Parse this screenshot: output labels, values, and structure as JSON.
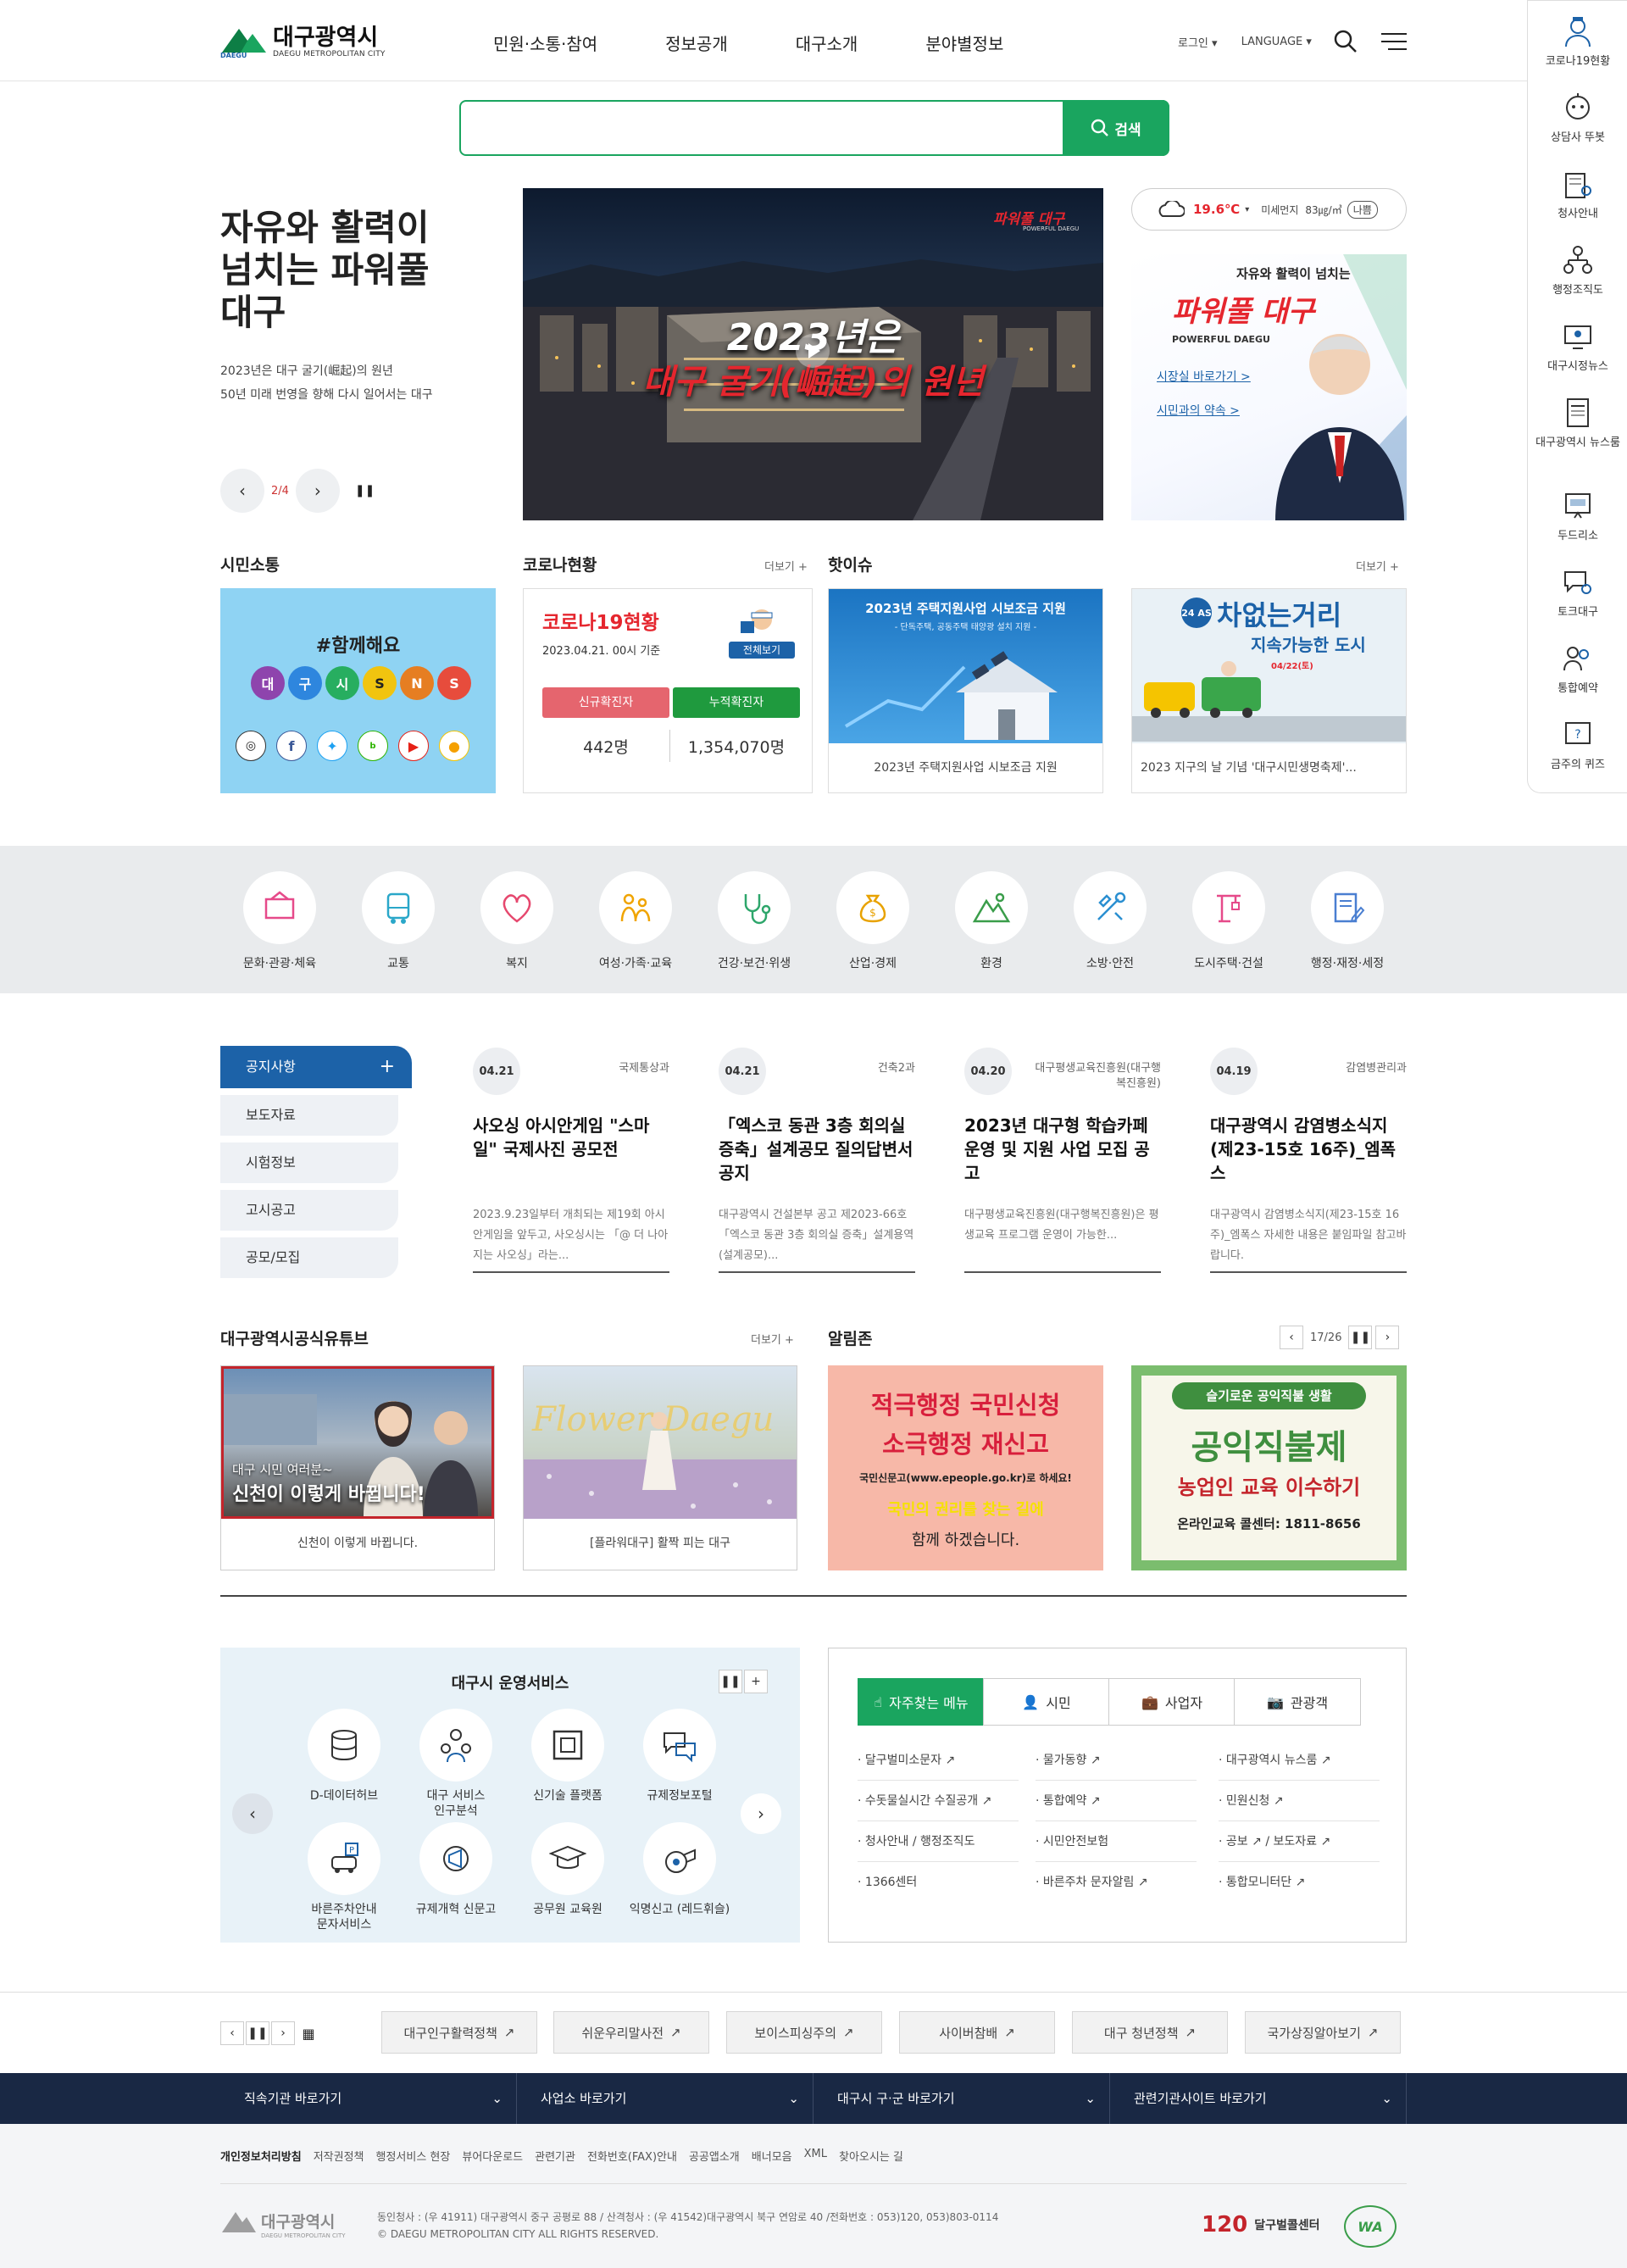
{
  "header": {
    "logo_text": "대구광역시",
    "logo_sub": "DAEGU METROPOLITAN CITY",
    "logo_mark": "DAEGU",
    "nav": [
      "민원·소통·참여",
      "정보공개",
      "대구소개",
      "분야별정보"
    ],
    "login": "로그인",
    "language": "LANGUAGE"
  },
  "quick_menu": [
    "코로나19현황",
    "상담사 뚜봇",
    "청사안내",
    "행정조직도",
    "대구시정뉴스",
    "대구광역시 뉴스룸",
    "두드리소",
    "토크대구",
    "통합예약",
    "금주의 퀴즈"
  ],
  "search": {
    "placeholder": "",
    "button": "검색"
  },
  "hero": {
    "title_lines": [
      "자유와 활력이",
      "넘치는 파워풀",
      "대구"
    ],
    "desc_lines": [
      "2023년은 대구 굴기(崛起)의 원년",
      "50년 미래 번영을 향해 다시 일어서는 대구"
    ],
    "page": "2/4",
    "image_brand": "파워풀 대구",
    "image_brand_sub": "POWERFUL DAEGU",
    "image_line1": "2023년은",
    "image_line2": "대구 굴기(崛起)의 원년"
  },
  "weather": {
    "temp": "19.6℃",
    "dust_label": "미세먼지",
    "dust_value": "83㎍/㎥",
    "dust_status": "나쁨"
  },
  "mayor": {
    "slogan": "자유와 활력이 넘치는",
    "title": "파워풀 대구",
    "sub": "POWERFUL DAEGU",
    "link1": "시장실 바로가기 >",
    "link2": "시민과의 약속 >"
  },
  "citizen": {
    "title": "시민소통",
    "hashtag": "#함께해요",
    "bubbles": [
      "대",
      "구",
      "시",
      "S",
      "N",
      "S"
    ]
  },
  "covid": {
    "title": "코로나현황",
    "more": "더보기 +",
    "card_title": "코로나19현황",
    "date": "2023.04.21. 00시 기준",
    "all_btn": "전체보기",
    "new_label": "신규확진자",
    "total_label": "누적확진자",
    "new_value": "442명",
    "total_value": "1,354,070명"
  },
  "hot": {
    "title": "핫이슈",
    "more": "더보기 +",
    "items": [
      {
        "img_title": "2023년 주택지원사업 시보조금 지원",
        "img_sub": "- 단독주택, 공동주택 태양광 설치 지원 -",
        "caption": "2023년 주택지원사업 시보조금 지원"
      },
      {
        "img_title": "차없는거리",
        "img_sub": "지속가능한 도시",
        "badge": "24 AS",
        "date_text": "04/22(토)",
        "caption": "2023 지구의 날 기념 '대구시민생명축제'..."
      }
    ]
  },
  "categories": [
    "문화·관광·체육",
    "교통",
    "복지",
    "여성·가족·교육",
    "건강·보건·위생",
    "산업·경제",
    "환경",
    "소방·안전",
    "도시주택·건설",
    "행정·재정·세정"
  ],
  "notice": {
    "tabs": [
      "공지사항",
      "보도자료",
      "시험정보",
      "고시공고",
      "공모/모집"
    ],
    "items": [
      {
        "date": "04.21",
        "dept": "국제통상과",
        "title": "사오싱 아시안게임 \"스마일\" 국제사진 공모전",
        "body": "2023.9.23일부터 개최되는 제19회 아시안게임을 앞두고, 사오싱시는 「@ 더 나아지는 사오싱」라는..."
      },
      {
        "date": "04.21",
        "dept": "건축2과",
        "title": "「엑스코 동관 3층 회의실 증축」설계공모 질의답변서 공지",
        "body": "대구광역시 건설본부 공고 제2023-66호 「엑스코 동관 3층 회의실 증축」설계용역(설계공모)..."
      },
      {
        "date": "04.20",
        "dept": "대구평생교육진흥원(대구행복진흥원)",
        "title": "2023년 대구형 학습카페 운영 및 지원 사업 모집 공고",
        "body": "대구평생교육진흥원(대구행복진흥원)은 평생교육 프로그램 운영이 가능한..."
      },
      {
        "date": "04.19",
        "dept": "감염병관리과",
        "title": "대구광역시 감염병소식지(제23-15호 16주)_엠폭스",
        "body": "대구광역시 감염병소식지(제23-15호 16주)_엠폭스 자세한 내용은 붙임파일 참고바랍니다."
      }
    ]
  },
  "youtube": {
    "title": "대구광역시공식유튜브",
    "more": "더보기 +",
    "items": [
      {
        "overlay1": "대구 시민 여러분~",
        "overlay2": "신천이 이렇게 바뀝니다!",
        "caption": "신천이 이렇게 바뀝니다."
      },
      {
        "overlay1": "Flower Daegu",
        "caption": "[플라워대구] 활짝 피는 대구"
      }
    ]
  },
  "alarm": {
    "title": "알림존",
    "page": "17/26",
    "items": [
      {
        "l1": "적극행정 국민신청",
        "l2": "소극행정 재신고",
        "l3": "국민신문고(www.epeople.go.kr)로 하세요!",
        "l4": "국민의 권리를 찾는 길에",
        "l5": "함께 하겠습니다."
      },
      {
        "l1": "슬기로운 공익직불 생활",
        "l2": "공익직불제",
        "l3": "농업인 교육 이수하기",
        "l4": "온라인교육 콜센터: 1811-8656"
      }
    ]
  },
  "ops": {
    "title": "대구시 운영서비스",
    "items": [
      "D-데이터허브",
      "대구 서비스 인구분석",
      "신기술 플랫폼",
      "규제정보포털",
      "바른주차안내 문자서비스",
      "규제개혁 신문고",
      "공무원 교육원",
      "익명신고 (레드휘슬)"
    ]
  },
  "fav": {
    "tabs": [
      "자주찾는 메뉴",
      "시민",
      "사업자",
      "관광객"
    ],
    "links": [
      "달구벌미소문자",
      "물가동향",
      "대구광역시 뉴스룸",
      "수돗물실시간 수질공개",
      "통합예약",
      "민원신청",
      "청사안내 / 행정조직도",
      "시민안전보험",
      "공보",
      "1366센터",
      "바른주차 문자알림",
      "통합모니터단"
    ],
    "link_extra": "/ 보도자료"
  },
  "banners": [
    "대구인구활력정책",
    "쉬운우리말사전",
    "보이스피싱주의",
    "사이버참배",
    "대구 청년정책",
    "국가상징알아보기"
  ],
  "sites": [
    "직속기관 바로가기",
    "사업소 바로가기",
    "대구시 구·군 바로가기",
    "관련기관사이트 바로가기"
  ],
  "footer": {
    "links": [
      "개인정보처리방침",
      "저작권정책",
      "행정서비스 현장",
      "뷰어다운로드",
      "관련기관",
      "전화번호(FAX)안내",
      "공공앱소개",
      "배너모음",
      "XML",
      "찾아오시는 길"
    ],
    "address": "동인청사 : (우 41911) 대구광역시 중구 공평로 88 / 산격청사 : (우 41542)대구광역시 북구 연암로 40 /전화번호 : 053)120, 053)803-0114",
    "copyright": "© DAEGU METROPOLITAN CITY ALL RIGHTS RESERVED.",
    "call_num": "120",
    "call_label": "달구벌콜센터",
    "wa": "WA"
  },
  "colors": {
    "green": "#1aa55f",
    "blue": "#1c62a8",
    "navy": "#192844",
    "red": "#e5262e"
  }
}
